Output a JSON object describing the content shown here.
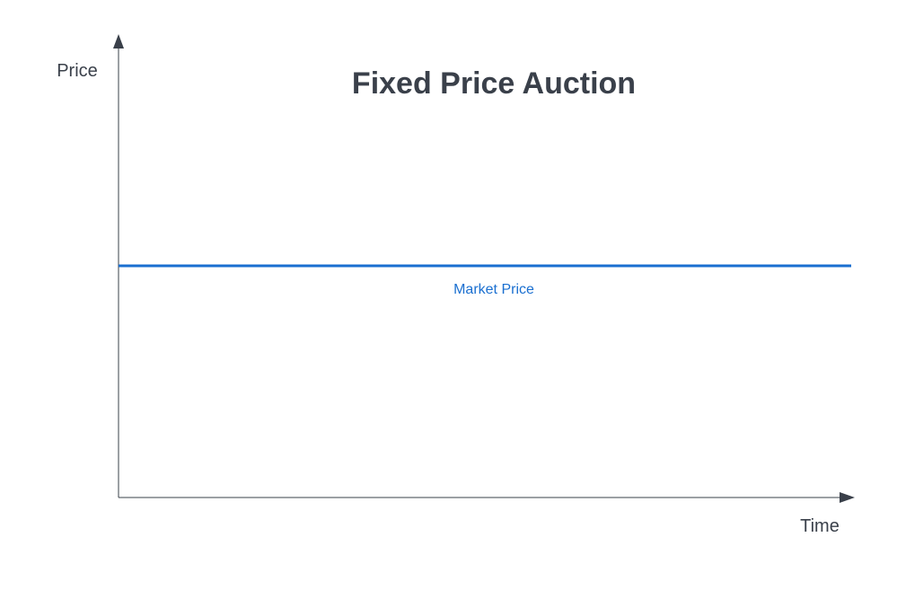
{
  "chart_data": {
    "type": "line",
    "title": "Fixed Price Auction",
    "xlabel": "Time",
    "ylabel": "Price",
    "grid": false,
    "axis_ticks": false,
    "series": [
      {
        "name": "Market Price",
        "level_fraction_of_y_axis": 0.5,
        "color": "#1a6fd0"
      }
    ],
    "colors": {
      "axis": "#3a404a",
      "title": "#3a404a",
      "series": "#1a6fd0"
    }
  }
}
